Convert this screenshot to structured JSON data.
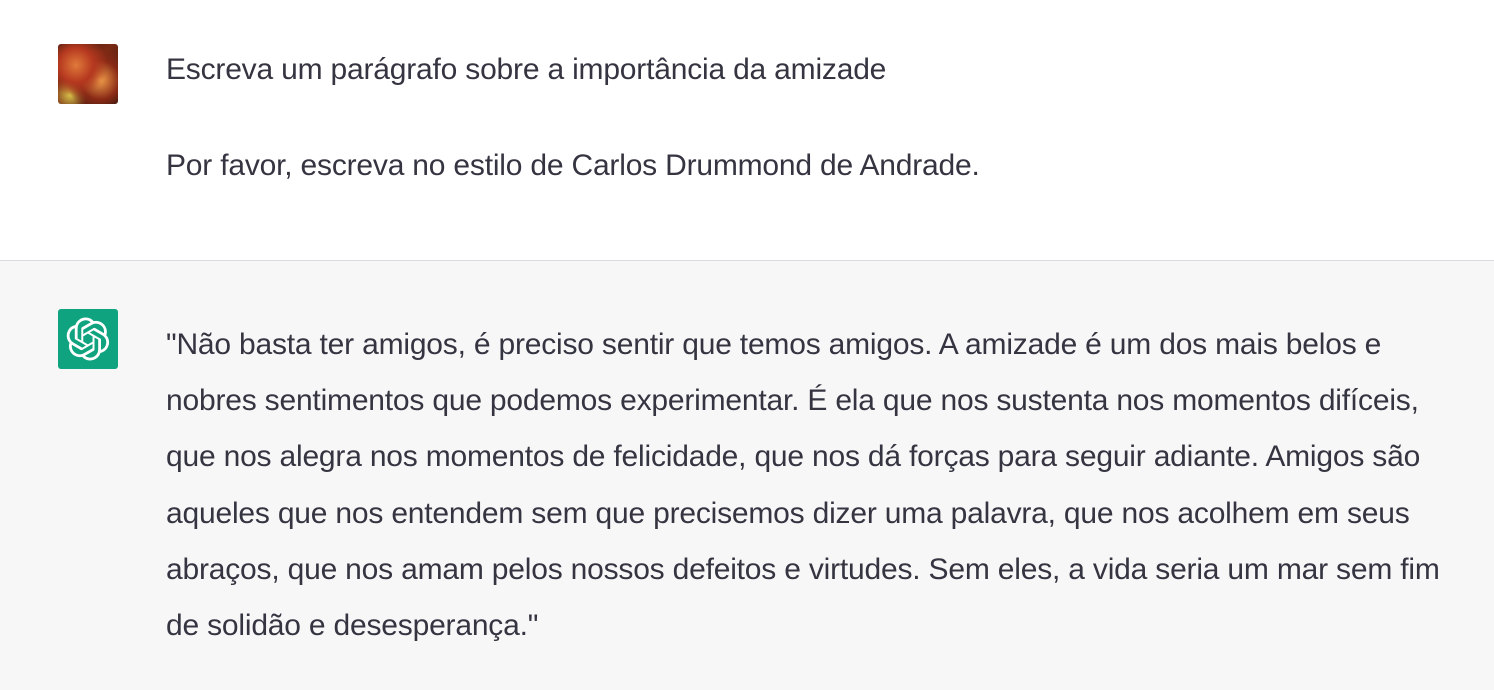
{
  "conversation": {
    "user_message": {
      "avatar_icon": "user-photo-avatar",
      "paragraphs": [
        "Escreva um parágrafo sobre a importância da amizade",
        "Por favor, escreva no estilo de Carlos Drummond de Andrade."
      ]
    },
    "assistant_message": {
      "avatar_icon": "openai-logo-icon",
      "avatar_color": "#10a37f",
      "text": "\"Não basta ter amigos, é preciso sentir que temos amigos. A amizade é um dos mais belos e nobres sentimentos que podemos experimentar. É ela que nos sustenta nos momentos difíceis, que nos alegra nos momentos de felicidade, que nos dá forças para seguir adiante. Amigos são aqueles que nos entendem sem que precisemos dizer uma palavra, que nos acolhem em seus abraços, que nos amam pelos nossos defeitos e virtudes. Sem eles, a vida seria um mar sem fim de solidão e desesperança.\""
    }
  },
  "colors": {
    "text": "#343541",
    "assistant_background": "#f7f7f8",
    "divider": "#d9d9e3"
  }
}
